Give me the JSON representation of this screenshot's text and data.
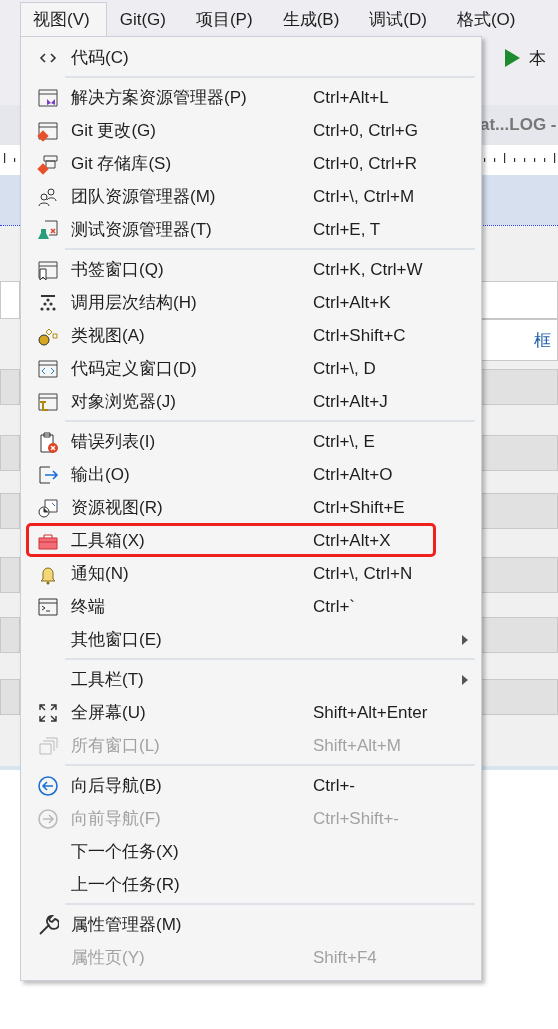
{
  "menubar": {
    "items": [
      {
        "label": "视图(V)",
        "selected": true
      },
      {
        "label": "Git(G)",
        "selected": false
      },
      {
        "label": "项目(P)",
        "selected": false
      },
      {
        "label": "生成(B)",
        "selected": false
      },
      {
        "label": "调试(D)",
        "selected": false
      },
      {
        "label": "格式(O)",
        "selected": false
      }
    ]
  },
  "toolbar": {
    "run_label": "本"
  },
  "document_tab": {
    "title": "at...LOG -"
  },
  "designer": {
    "label_text": "框"
  },
  "menu": {
    "items": [
      {
        "kind": "item",
        "label": "代码(C)",
        "disabled": false
      },
      {
        "kind": "separator"
      },
      {
        "kind": "item",
        "label": "解决方案资源管理器(P)",
        "shortcut": "Ctrl+Alt+L",
        "disabled": false
      },
      {
        "kind": "item",
        "label": "Git 更改(G)",
        "shortcut": "Ctrl+0, Ctrl+G",
        "disabled": false
      },
      {
        "kind": "item",
        "label": "Git 存储库(S)",
        "shortcut": "Ctrl+0, Ctrl+R",
        "disabled": false
      },
      {
        "kind": "item",
        "label": "团队资源管理器(M)",
        "shortcut": "Ctrl+\\, Ctrl+M",
        "disabled": false
      },
      {
        "kind": "item",
        "label": "测试资源管理器(T)",
        "shortcut": "Ctrl+E, T",
        "disabled": false
      },
      {
        "kind": "separator"
      },
      {
        "kind": "item",
        "label": "书签窗口(Q)",
        "shortcut": "Ctrl+K, Ctrl+W",
        "disabled": false
      },
      {
        "kind": "item",
        "label": "调用层次结构(H)",
        "shortcut": "Ctrl+Alt+K",
        "disabled": false
      },
      {
        "kind": "item",
        "label": "类视图(A)",
        "shortcut": "Ctrl+Shift+C",
        "disabled": false
      },
      {
        "kind": "item",
        "label": "代码定义窗口(D)",
        "shortcut": "Ctrl+\\, D",
        "disabled": false
      },
      {
        "kind": "item",
        "label": "对象浏览器(J)",
        "shortcut": "Ctrl+Alt+J",
        "disabled": false
      },
      {
        "kind": "separator"
      },
      {
        "kind": "item",
        "label": "错误列表(I)",
        "shortcut": "Ctrl+\\, E",
        "disabled": false
      },
      {
        "kind": "item",
        "label": "输出(O)",
        "shortcut": "Ctrl+Alt+O",
        "disabled": false
      },
      {
        "kind": "item",
        "label": "资源视图(R)",
        "shortcut": "Ctrl+Shift+E",
        "disabled": false
      },
      {
        "kind": "item",
        "label": "工具箱(X)",
        "shortcut": "Ctrl+Alt+X",
        "disabled": false,
        "annotated": true
      },
      {
        "kind": "item",
        "label": "通知(N)",
        "shortcut": "Ctrl+\\, Ctrl+N",
        "disabled": false
      },
      {
        "kind": "item",
        "label": "终端",
        "shortcut": "Ctrl+`",
        "disabled": false
      },
      {
        "kind": "item",
        "label": "其他窗口(E)",
        "disabled": false,
        "submenu": true
      },
      {
        "kind": "separator"
      },
      {
        "kind": "item",
        "label": "工具栏(T)",
        "disabled": false,
        "submenu": true
      },
      {
        "kind": "item",
        "label": "全屏幕(U)",
        "shortcut": "Shift+Alt+Enter",
        "disabled": false
      },
      {
        "kind": "item",
        "label": "所有窗口(L)",
        "shortcut": "Shift+Alt+M",
        "disabled": true
      },
      {
        "kind": "separator"
      },
      {
        "kind": "item",
        "label": "向后导航(B)",
        "shortcut": "Ctrl+-",
        "disabled": false
      },
      {
        "kind": "item",
        "label": "向前导航(F)",
        "shortcut": "Ctrl+Shift+-",
        "disabled": true
      },
      {
        "kind": "item",
        "label": "下一个任务(X)",
        "disabled": false
      },
      {
        "kind": "item",
        "label": "上一个任务(R)",
        "disabled": false
      },
      {
        "kind": "separator"
      },
      {
        "kind": "item",
        "label": "属性管理器(M)",
        "disabled": false
      },
      {
        "kind": "item",
        "label": "属性页(Y)",
        "shortcut": "Shift+F4",
        "disabled": true
      }
    ]
  }
}
